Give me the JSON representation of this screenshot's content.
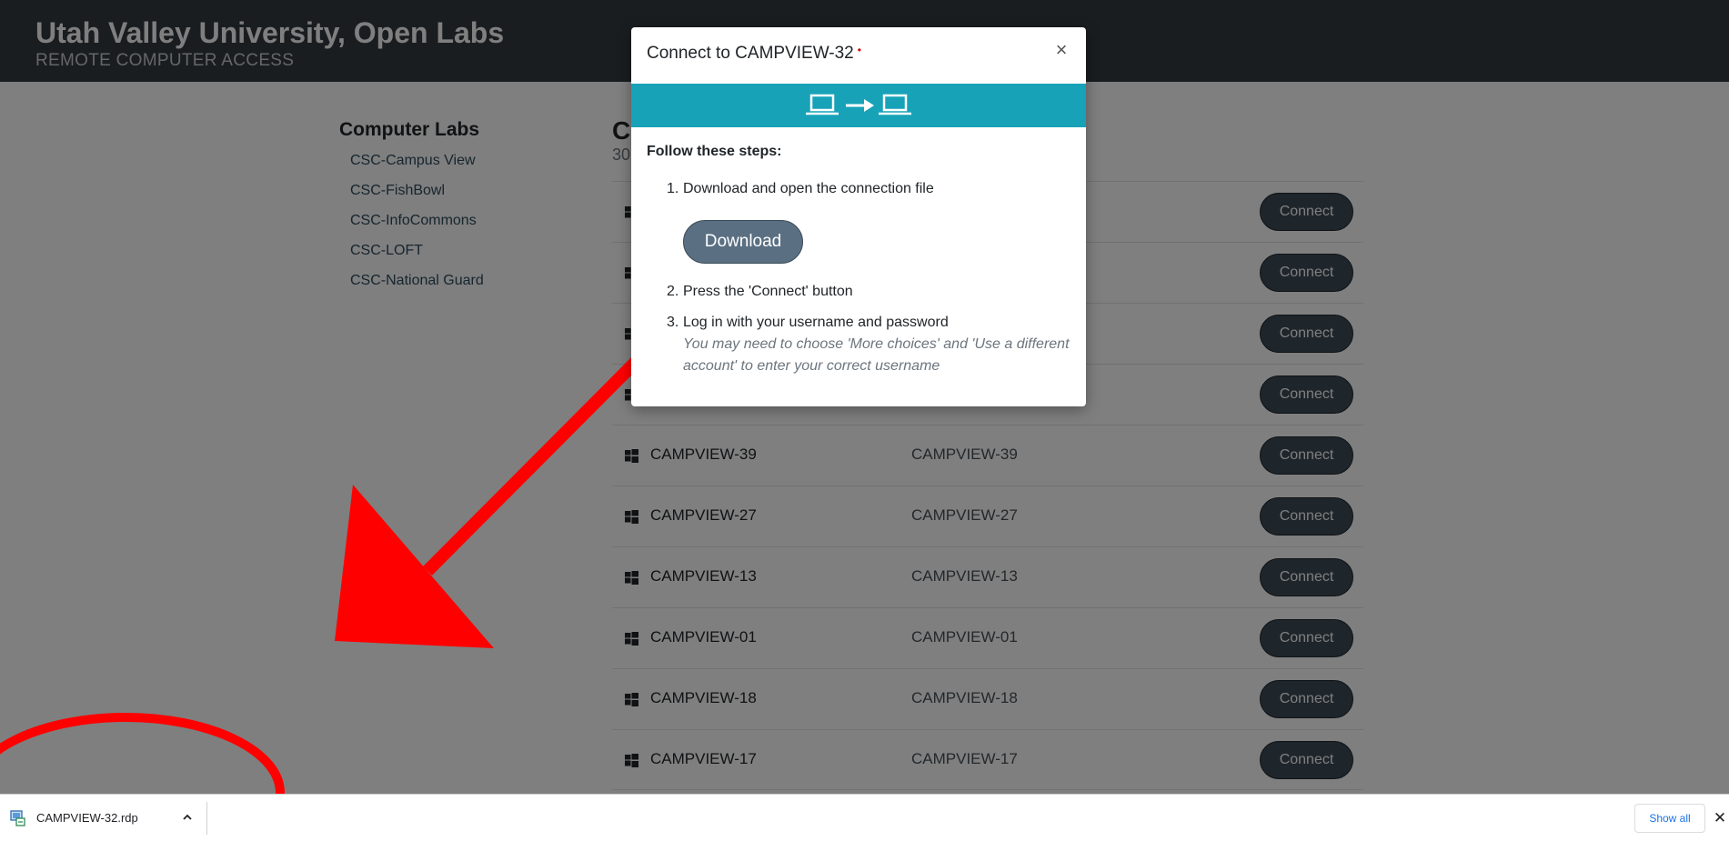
{
  "header": {
    "title": "Utah Valley University, Open Labs",
    "subtitle": "REMOTE COMPUTER ACCESS"
  },
  "sidebar": {
    "heading": "Computer Labs",
    "items": [
      {
        "label": "CSC-Campus View"
      },
      {
        "label": "CSC-FishBowl"
      },
      {
        "label": "CSC-InfoCommons"
      },
      {
        "label": "CSC-LOFT"
      },
      {
        "label": "CSC-National Guard"
      }
    ]
  },
  "main": {
    "heading": "C",
    "count": "30",
    "rows": [
      {
        "name": "",
        "host": "",
        "action": "Connect"
      },
      {
        "name": "",
        "host": "",
        "action": "Connect"
      },
      {
        "name": "",
        "host": "",
        "action": "Connect"
      },
      {
        "name": "",
        "host": "",
        "action": "Connect"
      },
      {
        "name": "CAMPVIEW-39",
        "host": "CAMPVIEW-39",
        "action": "Connect"
      },
      {
        "name": "CAMPVIEW-27",
        "host": "CAMPVIEW-27",
        "action": "Connect"
      },
      {
        "name": "CAMPVIEW-13",
        "host": "CAMPVIEW-13",
        "action": "Connect"
      },
      {
        "name": "CAMPVIEW-01",
        "host": "CAMPVIEW-01",
        "action": "Connect"
      },
      {
        "name": "CAMPVIEW-18",
        "host": "CAMPVIEW-18",
        "action": "Connect"
      },
      {
        "name": "CAMPVIEW-17",
        "host": "CAMPVIEW-17",
        "action": "Connect"
      }
    ]
  },
  "modal": {
    "title": "Connect to CAMPVIEW-32",
    "required_mark": "•",
    "close_label": "×",
    "steps_heading": "Follow these steps:",
    "steps": [
      {
        "num": "1.",
        "text": "Download and open the connection file"
      },
      {
        "num": "2.",
        "text": "Press the 'Connect' button"
      },
      {
        "num": "3.",
        "text": "Log in with your username and password"
      }
    ],
    "step3_hint": "You may need to choose 'More choices' and 'Use a different account' to enter your correct username",
    "download_label": "Download",
    "banner_color": "#17a2b8"
  },
  "download_shelf": {
    "file_name": "CAMPVIEW-32.rdp",
    "show_all_label": "Show all",
    "close_label": "✕"
  },
  "colors": {
    "header_bg": "#343a40",
    "connect_bg": "#3d4a57",
    "annotation_red": "#ff0000",
    "link_blue": "#1a73e8"
  }
}
